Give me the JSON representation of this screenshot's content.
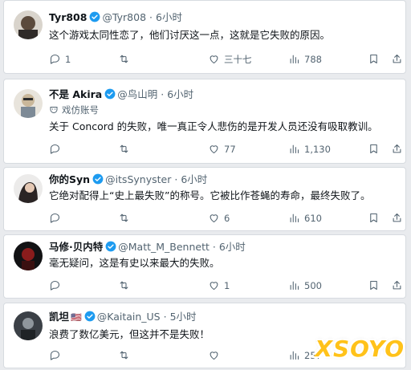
{
  "tweets": [
    {
      "name": "Tyr808",
      "handle": "@Tyr808",
      "dot": "·",
      "time": "6小时",
      "text": "这个游戏太同性恋了，他们讨厌这一点，这就是它失败的原因。",
      "reply": "1",
      "retweet": "",
      "like": "三十七",
      "views": "788"
    },
    {
      "name": "不是 Akira",
      "handle": "@鸟山明",
      "dot": "·",
      "time": "6小时",
      "tag": "戏仿账号",
      "text": "关于 Concord 的失败，唯一真正令人悲伤的是开发人员还没有吸取教训。",
      "reply": "",
      "retweet": "",
      "like": "77",
      "views": "1,130"
    },
    {
      "name": "你的Syn",
      "handle": "@itsSynyster",
      "dot": "·",
      "time": "6小时",
      "text_lines": [
        "它绝对配得上“史上最失败”的称号。它被比作苍蝇的寿命，最终失败了。"
      ],
      "reply": "",
      "retweet": "",
      "like": "6",
      "views": "610"
    },
    {
      "name": "马修·贝内特",
      "handle": "@Matt_M_Bennett",
      "dot": "·",
      "time": "6小时",
      "text": "毫无疑问，这是有史以来最大的失败。",
      "reply": "",
      "retweet": "",
      "like": "1",
      "views": "500"
    },
    {
      "name": "凯坦",
      "flag": "🇺🇸",
      "handle": "@Kaitain_US",
      "dot": "·",
      "time": "5小时",
      "text": "浪费了数亿美元，但这并不是失败！",
      "reply": "",
      "retweet": "",
      "like": "",
      "views": "257"
    }
  ],
  "watermark": "XSOYO",
  "colors": {
    "verified": "#1d9bf0",
    "muted": "#536471",
    "watermark": "#ffc21a"
  },
  "icons": [
    "reply-icon",
    "retweet-icon",
    "heart-icon",
    "views-icon",
    "bookmark-icon",
    "share-icon",
    "verified-badge-icon",
    "parody-mask-icon"
  ]
}
